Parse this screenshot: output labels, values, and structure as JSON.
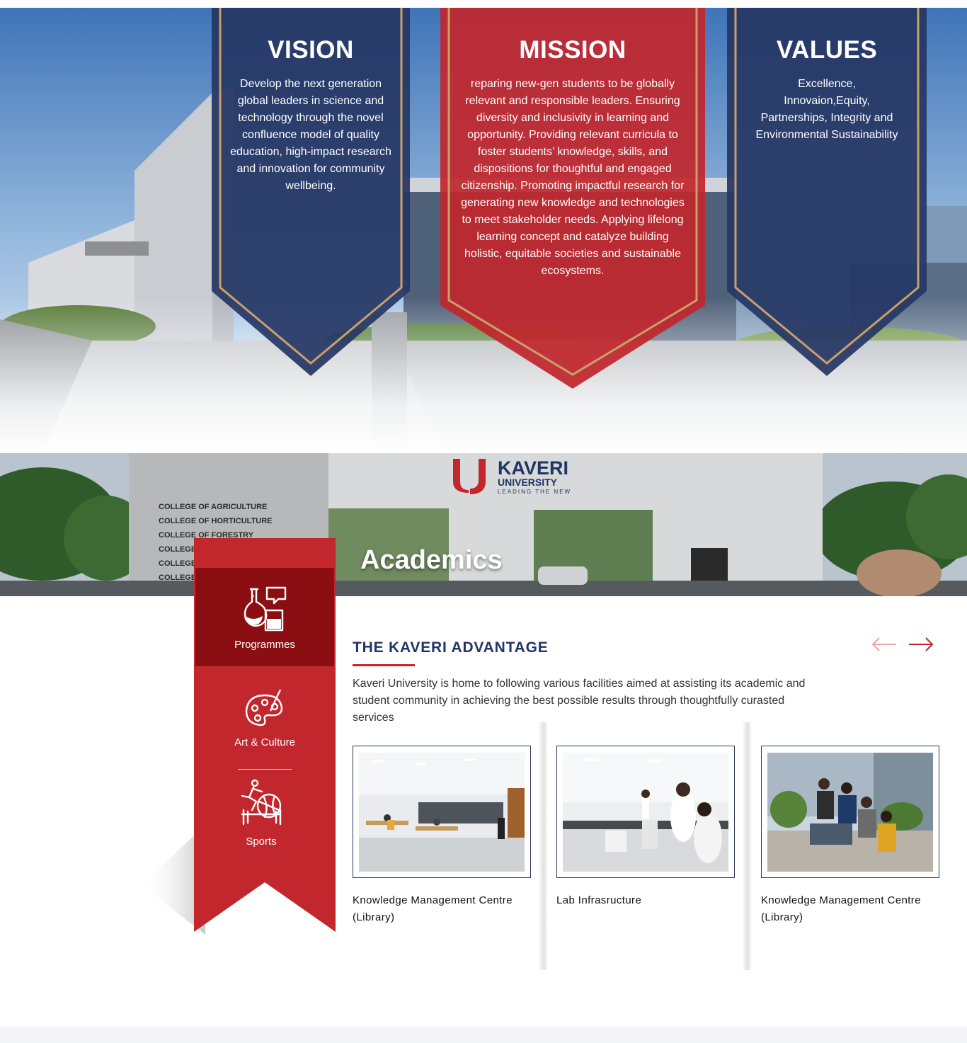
{
  "hero": {
    "vision": {
      "title": "VISION",
      "text": "Develop the next generation global leaders in science and technology through the novel confluence model of quality education, high-impact research and innovation for community wellbeing."
    },
    "mission": {
      "title": "MISSION",
      "text": "reparing new-gen students to be globally relevant and responsible leaders. Ensuring diversity and inclusivity in learning and opportunity. Providing relevant curricula to foster students’ knowledge, skills, and dispositions for thoughtful and engaged citizenship. Promoting impactful research for generating new knowledge and technologies to meet stakeholder needs. Applying lifelong learning concept and catalyze building holistic, equitable societies and sustainable ecosystems."
    },
    "values": {
      "title": "VALUES",
      "text": "Excellence, Innovaion,Equity, Partnerships, Integrity and Environmental Sustainability"
    }
  },
  "academics": {
    "title": "Academics",
    "signage": {
      "brand": "KAVERI",
      "brand_sub": "UNIVERSITY",
      "tagline": "LEADING THE NEW",
      "colleges": [
        "COLLEGE OF AGRICULTURE",
        "COLLEGE OF HORTICULTURE",
        "COLLEGE OF FORESTRY",
        "COLLEGE",
        "COLLEGE",
        "COLLEGE"
      ]
    }
  },
  "tabs": [
    {
      "label": "Programmes",
      "icon": "lab-flask-icon",
      "active": true
    },
    {
      "label": "Art & Culture",
      "icon": "palette-icon",
      "active": false
    },
    {
      "label": "Sports",
      "icon": "sports-icon",
      "active": false
    }
  ],
  "advantage": {
    "title": "THE KAVERI ADVANTAGE",
    "description": "Kaveri University is home to following various facilities aimed at assisting its academic and student community in achieving the best possible results through thoughtfully curasted services",
    "prev_icon": "arrow-left-icon",
    "next_icon": "arrow-right-icon",
    "cards": [
      {
        "caption": "Knowledge Management Centre (Library)"
      },
      {
        "caption": "Lab Infrasructure"
      },
      {
        "caption": "Knowledge Management Centre (Library)"
      }
    ]
  },
  "colors": {
    "navy": "#263764",
    "red": "#c1272d",
    "dark_red": "#8b0f12",
    "gold": "#c9a06a"
  }
}
